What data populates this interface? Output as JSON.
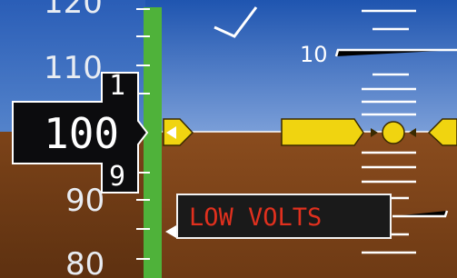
{
  "airspeed_tape": {
    "current_speed": "100",
    "drum_upper_digit": "1",
    "drum_lower_digit": "9",
    "ticks": [
      {
        "label": "120"
      },
      {
        "label": "110"
      },
      {
        "label": "90"
      },
      {
        "label": "80"
      }
    ]
  },
  "attitude_indicator": {
    "pitch_label": "10",
    "bank_pointer": "checkmark"
  },
  "alerts": {
    "annunciation": "LOW VOLTS"
  },
  "colors": {
    "sky": "#3a6fc0",
    "ground": "#8a4c1e",
    "tape_background": "#2a2a2e",
    "speed_band": "#4fb23a",
    "aircraft_symbol": "#f0d410",
    "alert_text": "#e0301e",
    "alert_background": "#1a1a1a"
  }
}
